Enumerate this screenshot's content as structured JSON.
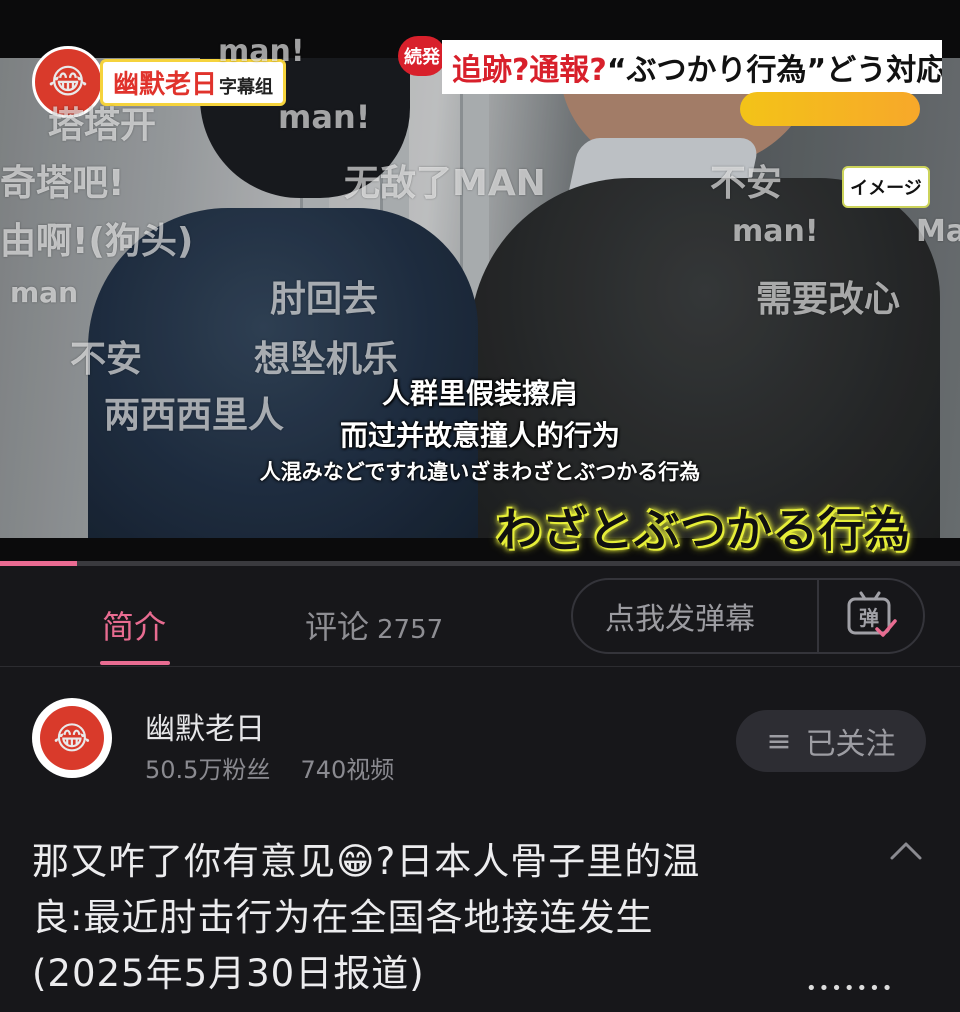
{
  "video": {
    "logo": {
      "name": "幽默老日",
      "suffix": "字幕组"
    },
    "banner": {
      "tag": "続発",
      "headline_red": "追跡?通報?",
      "headline_black": "“ぶつかり行為”どう対応"
    },
    "image_tag": "イメージ",
    "danmaku": [
      {
        "text": "man!"
      },
      {
        "text": "塔塔开"
      },
      {
        "text": "man!"
      },
      {
        "text": "奇塔吧!"
      },
      {
        "text": "无敌了MAN"
      },
      {
        "text": "不安"
      },
      {
        "text": "由啊!(狗头)"
      },
      {
        "text": "man!"
      },
      {
        "text": "Ma"
      },
      {
        "text": "man"
      },
      {
        "text": "肘回去"
      },
      {
        "text": "需要改心"
      },
      {
        "text": "不安"
      },
      {
        "text": "想坠机乐"
      },
      {
        "text": "两西西里人"
      }
    ],
    "subtitle_cn_line1": "人群里假装擦肩",
    "subtitle_cn_line2": "而过并故意撞人的行为",
    "subtitle_jp": "人混みなどですれ違いざまわざとぶつかる行為",
    "caption": "わざとぶつかる行為",
    "progress_fraction": 0.08
  },
  "tabs": {
    "intro": "简介",
    "comments": "评论",
    "comments_count": "2757",
    "danmaku_placeholder": "点我发弹幕",
    "danmaku_button_glyph": "弹"
  },
  "uploader": {
    "name": "幽默老日",
    "followers": "50.5万粉丝",
    "videos": "740视频",
    "follow_label": "已关注",
    "menu_glyph": "≡"
  },
  "title": {
    "line1": "那又咋了你有意见😁?日本人骨子里的温",
    "line2": "良:最近肘击行为在全国各地接连发生",
    "line3": "(2025年5月30日报道)"
  },
  "colors": {
    "accent": "#e86c91",
    "background": "#17171a",
    "caption_glow": "#e6ee3a"
  },
  "icons": {
    "collapse": "chevron-up-icon",
    "danmaku_send": "danmaku-send-icon",
    "follow_menu": "menu-icon"
  }
}
